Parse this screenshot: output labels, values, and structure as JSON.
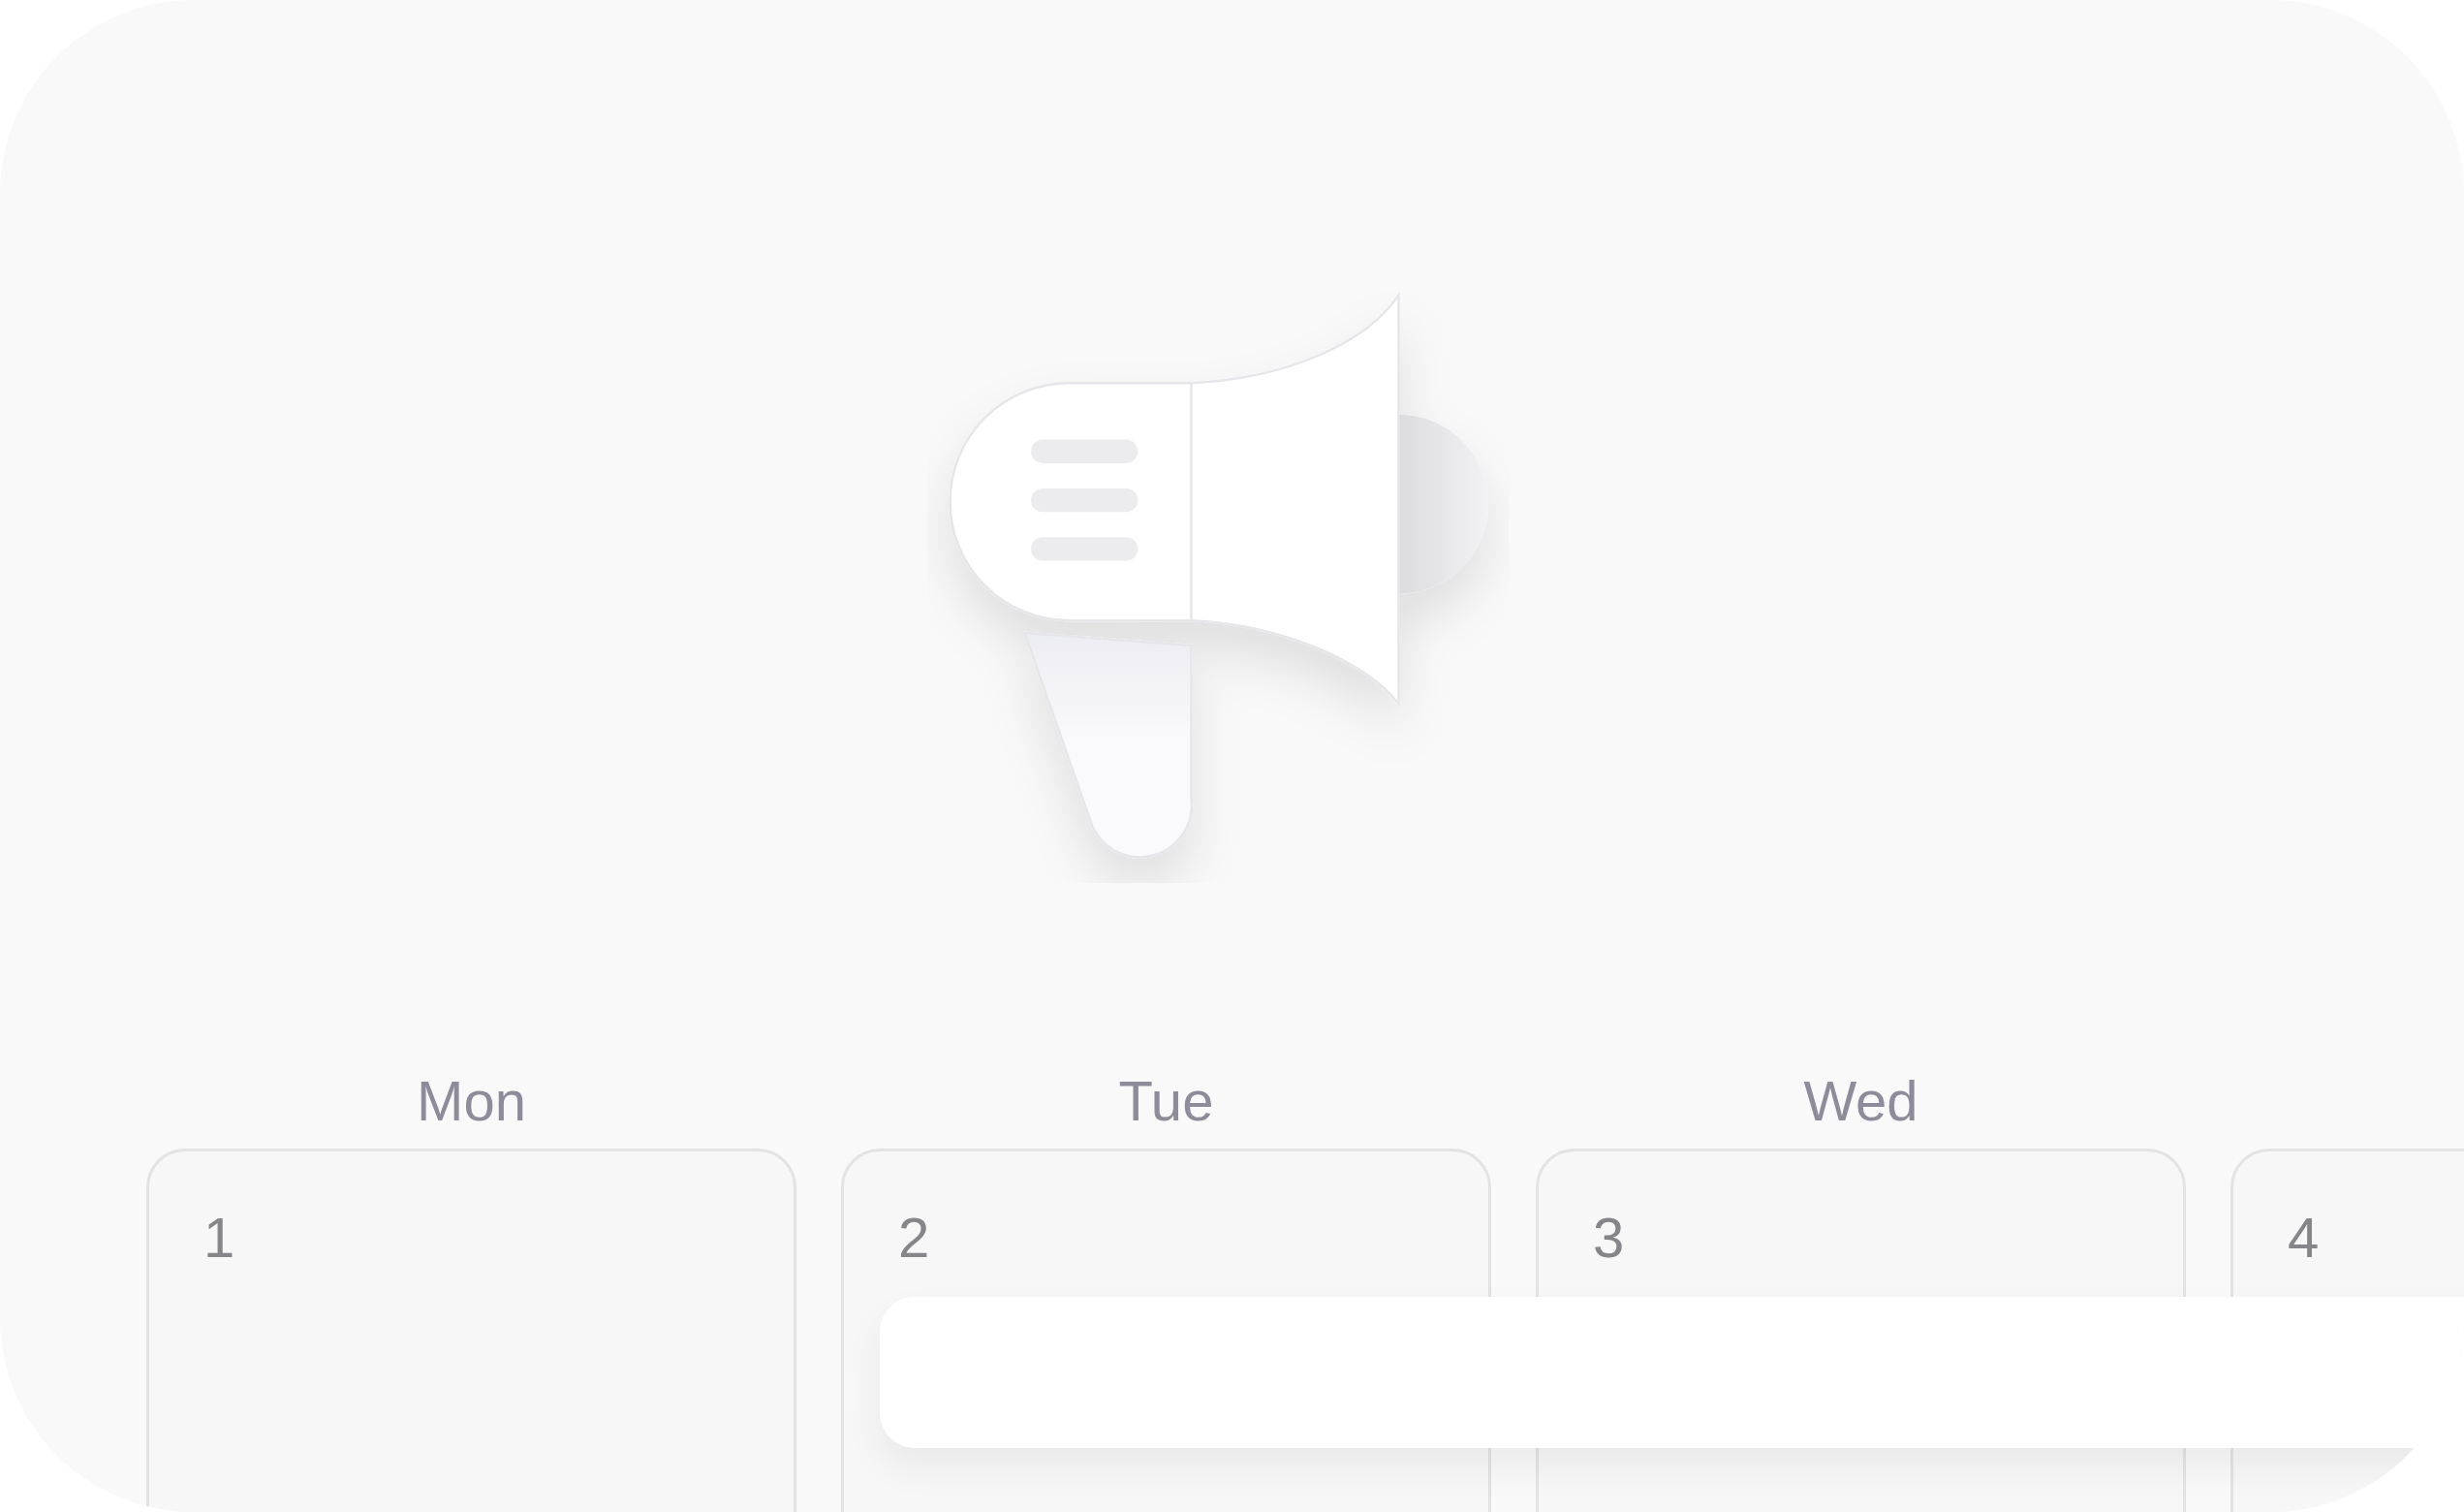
{
  "calendar": {
    "days": [
      {
        "label": "Mon",
        "date": "1"
      },
      {
        "label": "Tue",
        "date": "2"
      },
      {
        "label": "Wed",
        "date": "3"
      },
      {
        "date": "4"
      }
    ]
  }
}
